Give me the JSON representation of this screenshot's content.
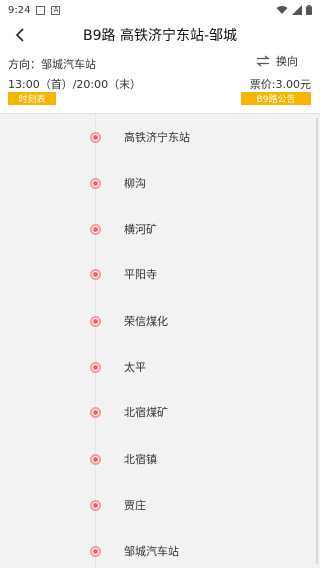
{
  "status_bar": {
    "time": "9:24",
    "icons": [
      "notification-box-icon",
      "a-icon",
      "wifi-icon",
      "cellular-icon",
      "battery-icon"
    ]
  },
  "header": {
    "title": "B9路 高铁济宁东站-邹城",
    "back_icon": "chevron-left-icon"
  },
  "info": {
    "direction": "方向：邹城汽车站",
    "swap_label": "换向",
    "hours": "13:00（首）/20:00（末）",
    "price": "票价:3.00元"
  },
  "buttons": {
    "timetable": "时刻表",
    "notice": "B9路公告"
  },
  "stops": [
    "高铁济宁东站",
    "柳沟",
    "横河矿",
    "平阳寺",
    "荣信煤化",
    "太平",
    "北宿煤矿",
    "北宿镇",
    "贾庄",
    "邹城汽车站"
  ],
  "colors": {
    "accent": "#f7b500",
    "stop_marker": "#f0636d",
    "list_bg": "#f2f2f2"
  }
}
